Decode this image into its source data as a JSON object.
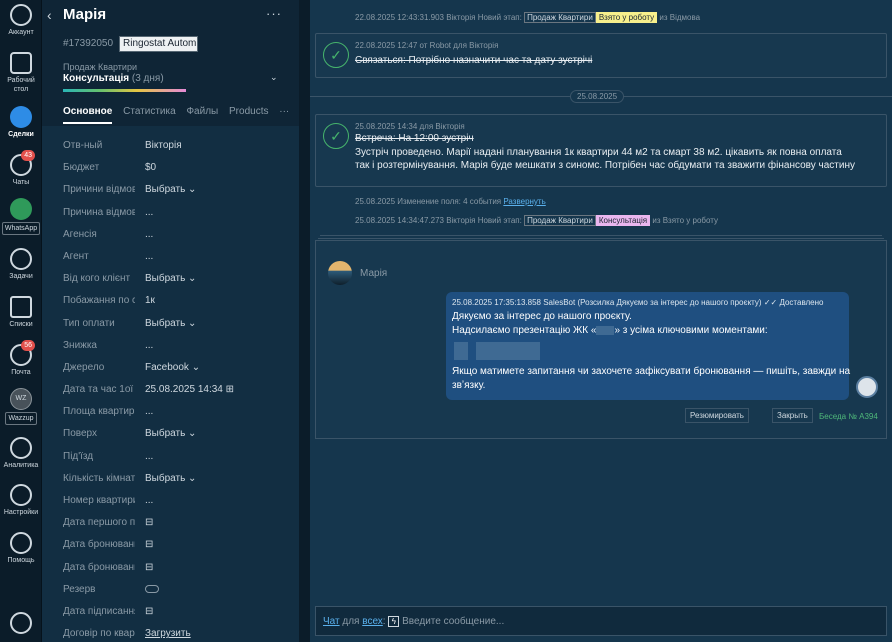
{
  "rail": {
    "account": "Аккаунт",
    "desktop": "Рабочий стол",
    "deals": "Сделки",
    "chats": "Чаты",
    "chats_badge": "43",
    "whatsapp": "WhatsApp",
    "tasks": "Задачи",
    "lists": "Списки",
    "mail": "Почта",
    "mail_badge": "56",
    "wazzup_logo": "WZ",
    "wazzup": "Wazzup",
    "analytics": "Аналитика",
    "settings": "Настройки",
    "help": "Помощь"
  },
  "lead": {
    "back": "‹",
    "name": "Марія",
    "menu": "···",
    "id": "#17392050",
    "tag": "Ringostat Autom",
    "pipeline": "Продаж Квартири",
    "stage": "Консультація",
    "stage_days": "(3 дня)",
    "tabs": [
      "Основное",
      "Статистика",
      "Файлы",
      "Products",
      "···"
    ]
  },
  "fields": [
    {
      "label": "Отв-ный",
      "value": "Вікторія"
    },
    {
      "label": "Бюджет",
      "value": "$0"
    },
    {
      "label": "Причини відмови",
      "value": "Выбрать ⌄"
    },
    {
      "label": "Причина відмови",
      "value": "..."
    },
    {
      "label": "Агенсія",
      "value": "..."
    },
    {
      "label": "Агент",
      "value": "..."
    },
    {
      "label": "Від кого клієнт",
      "value": "Выбрать ⌄"
    },
    {
      "label": "Побажання по с",
      "value": "1к"
    },
    {
      "label": "Тип оплати",
      "value": "Выбрать ⌄"
    },
    {
      "label": "Знижка",
      "value": "..."
    },
    {
      "label": "Джерело",
      "value": "Facebook ⌄"
    },
    {
      "label": "Дата та час 1ої",
      "value": "25.08.2025 14:34 ⊞"
    },
    {
      "label": "Площа квартири",
      "value": "..."
    },
    {
      "label": "Поверх",
      "value": "Выбрать ⌄"
    },
    {
      "label": "Під'їзд",
      "value": "..."
    },
    {
      "label": "Кількість кімнат",
      "value": "Выбрать ⌄"
    },
    {
      "label": "Номер квартири",
      "value": "..."
    },
    {
      "label": "Дата першого п",
      "value": "⊟"
    },
    {
      "label": "Дата бронюванн",
      "value": "⊟"
    },
    {
      "label": "Дата бронюванн",
      "value": "⊟"
    },
    {
      "label": "Резерв",
      "value": ""
    },
    {
      "label": "Дата підписання",
      "value": "⊟"
    },
    {
      "label": "Договір по квар",
      "value": "Загрузить"
    }
  ],
  "feed": {
    "top1": "22.08.2025 12:43:31.903 Вікторія Новий этап:",
    "top1_tag1": "Продаж Квартири",
    "top1_tag2": "Взято у роботу",
    "top1_tail": "из Відмова",
    "task1_meta": "22.08.2025 12:47 от Robot для Вікторія",
    "task1_text": "Связаться: Потрібно назначити час та дату зустрічі",
    "date_sep": "25.08.2025",
    "task2_meta": "25.08.2025 14:34 для Вікторія",
    "task2_title": "Встреча: На 12:00 зустріч",
    "task2_body": "Зустріч проведено. Марії надані планування 1к квартири 44 м2 та смарт 38 м2. цікавить як повна оплата так і розтермінування. Марія буде мешкати з синомс. Потрібен час обдумати та зважити фінансову частину",
    "change_line": "25.08.2025 Изменение поля: 4 события",
    "change_link": "Развернуть",
    "stage_line": "25.08.2025 14:34:47.273 Вікторія Новий этап:",
    "stage_tag1": "Продаж Квартири",
    "stage_tag2": "Консультація",
    "stage_tail": "из Взято у роботу"
  },
  "chat": {
    "contact": "Марія",
    "meta": "25.08.2025 17:35:13.858 SalesBot (Розсилка Дякуємо за інтерес до нашого проєкту)",
    "status": "✓✓ Доставлено",
    "line1": "Дякуємо за інтерес до нашого проєкту.",
    "line2a": "Надсилаємо презентацію ЖК «",
    "line2b": "» з усіма ключовими моментами:",
    "line3": "Якщо матимете запитання чи захочете зафіксувати бронювання — пишіть, завжди на",
    "line4": "звʼязку.",
    "summarize": "Резюмировать",
    "close": "Закрыть",
    "beseda": "Беседа № А394"
  },
  "composer": {
    "chat": "Чат",
    "for": "для",
    "all": "всех",
    "placeholder": "Введите сообщение..."
  }
}
